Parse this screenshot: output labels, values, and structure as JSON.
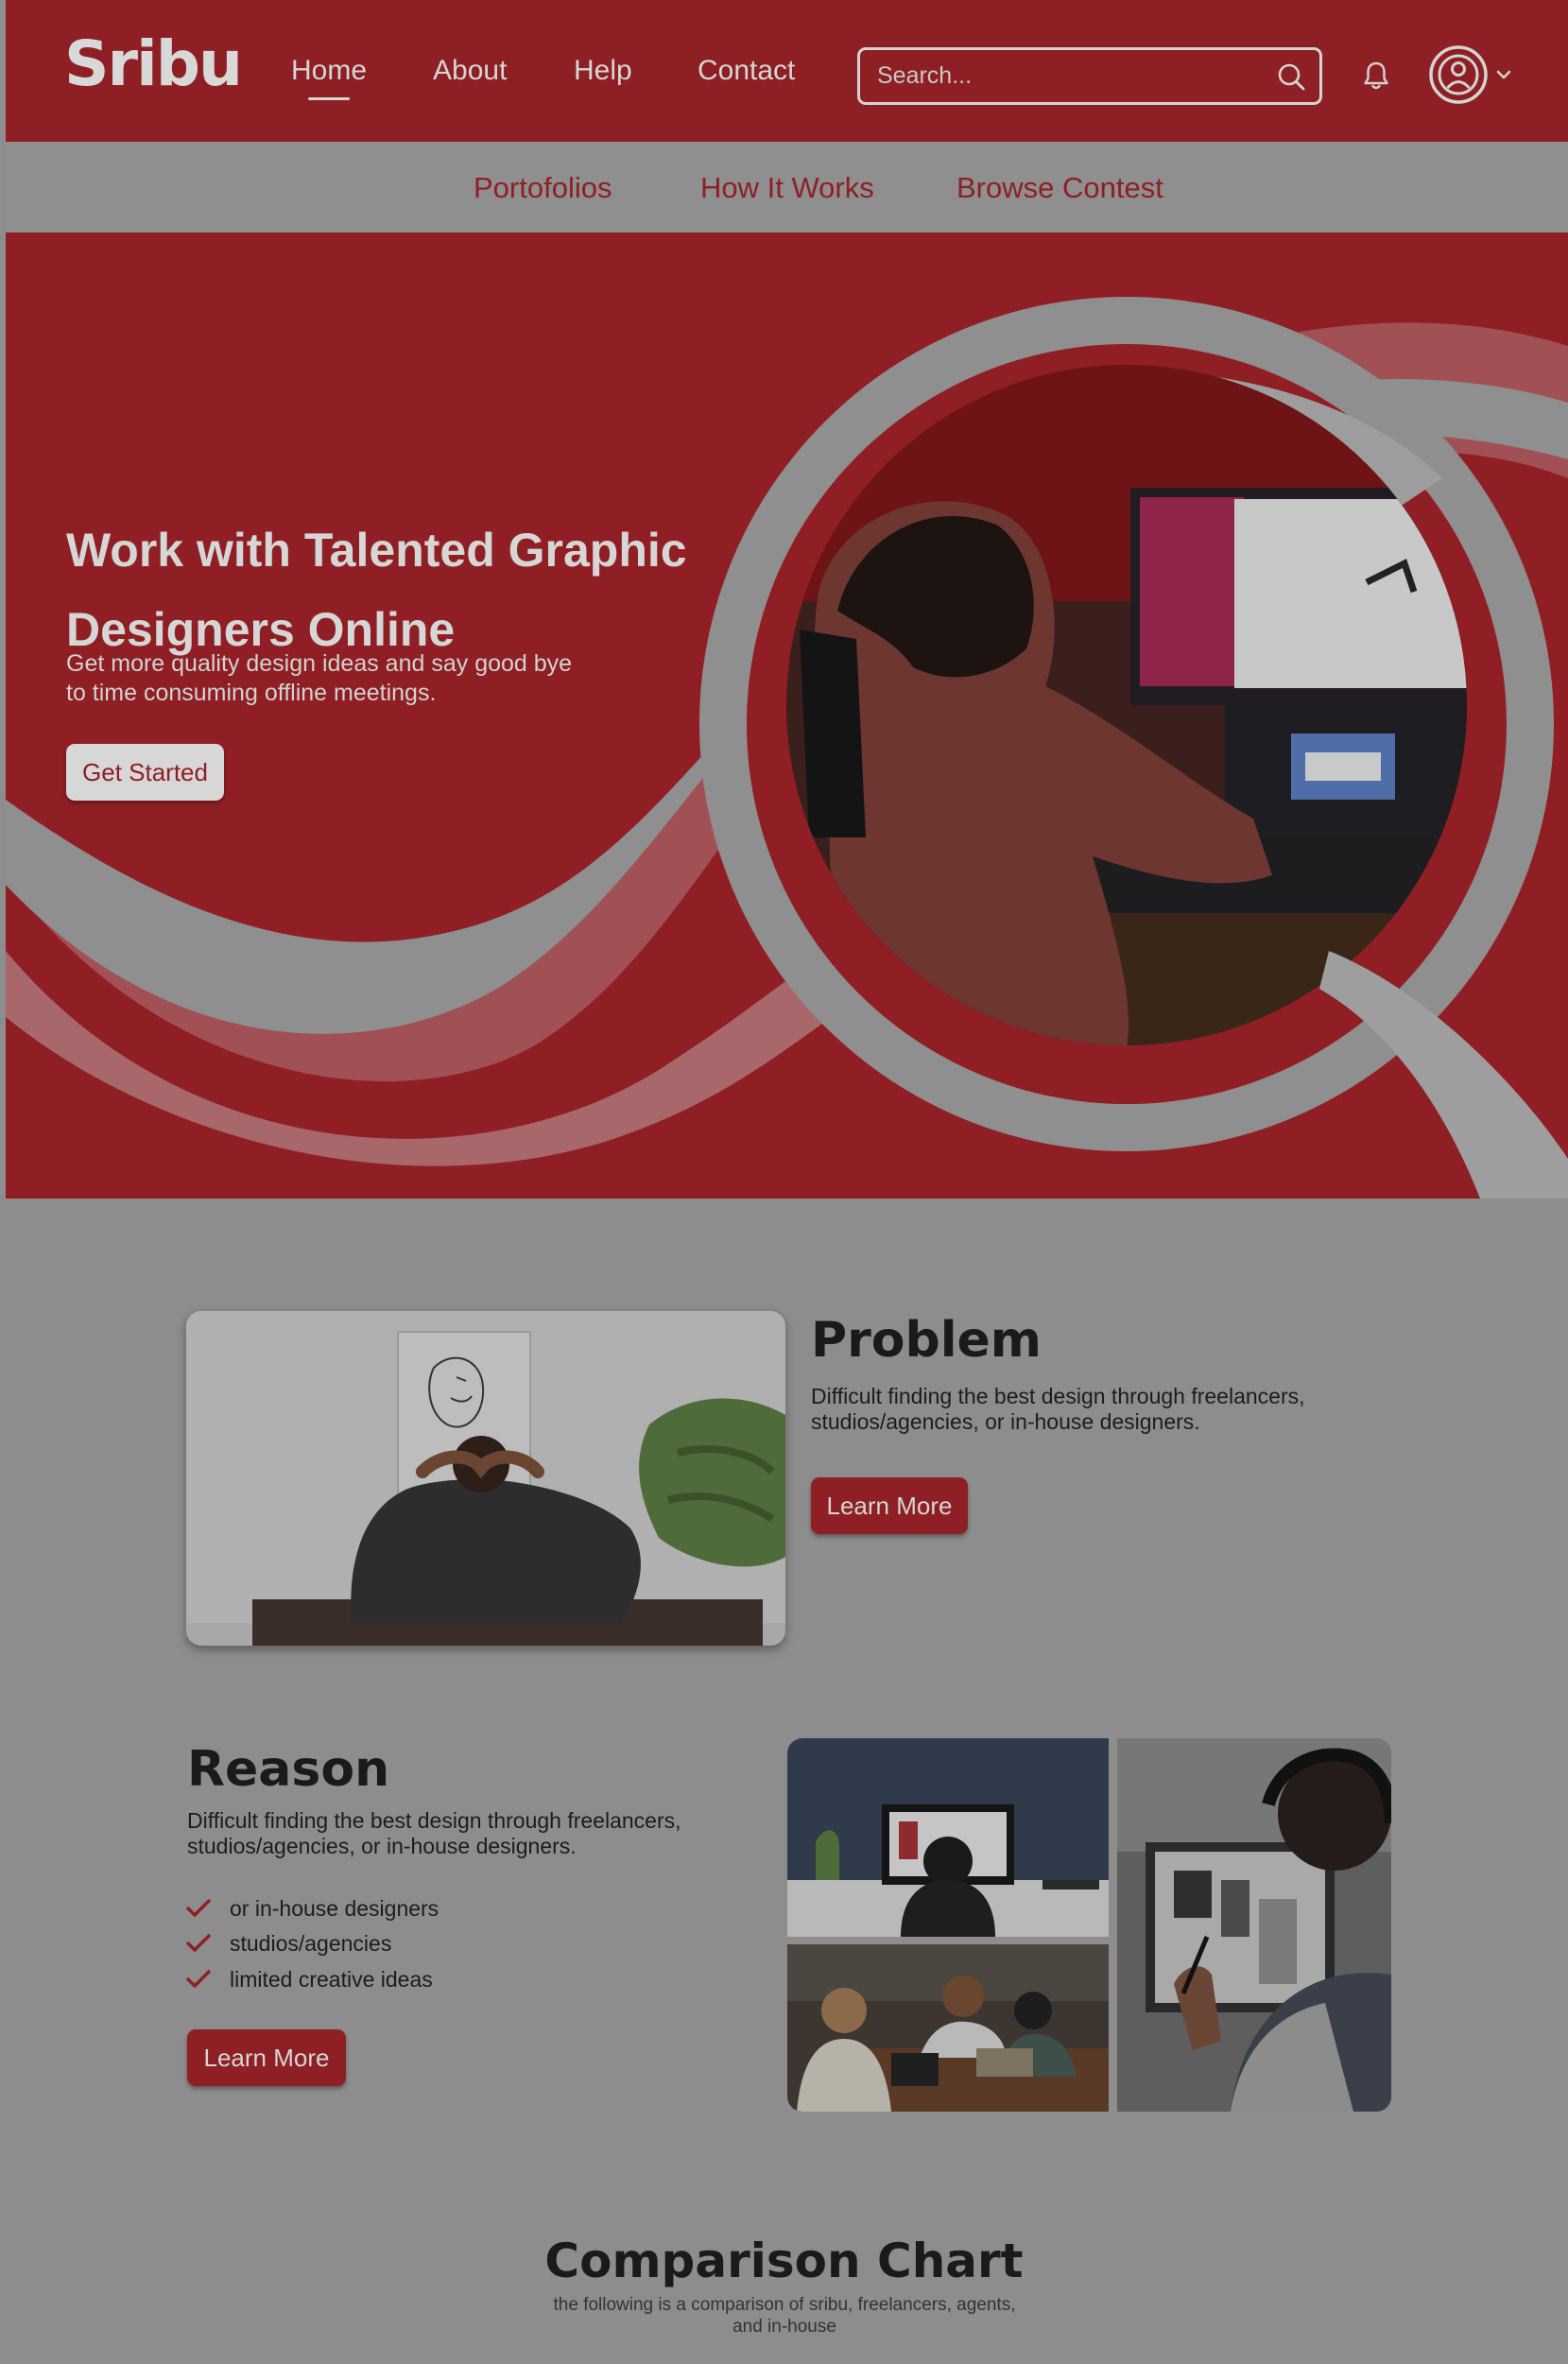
{
  "brand": {
    "logo_text": "Sribu"
  },
  "nav": {
    "links": [
      "Home",
      "About",
      "Help",
      "Contact"
    ],
    "active": "Home",
    "search_placeholder": "Search..."
  },
  "subnav": {
    "links": [
      "Portofolios",
      "How It Works",
      "Browse Contest"
    ]
  },
  "hero": {
    "title": "Work with Talented Graphic Designers Online",
    "subtitle": "Get more quality design ideas and say good bye to time consuming offline meetings.",
    "cta": "Get Started"
  },
  "problem": {
    "heading": "Problem",
    "text": "Difficult finding the best design through freelancers, studios/agencies, or in-house designers.",
    "cta": "Learn More"
  },
  "reason": {
    "heading": "Reason",
    "text": "Difficult finding the best design through freelancers, studios/agencies, or in-house designers.",
    "checklist": [
      "or in-house designers",
      "studios/agencies",
      "limited creative ideas"
    ],
    "cta": "Learn More"
  },
  "comparison": {
    "heading": "Comparison Chart",
    "subtitle": "the following is a comparison of sribu, freelancers, agents, and in-house"
  },
  "colors": {
    "brand_red": "#8e1f24",
    "overlay_gray": "#8d8d8d",
    "light_text": "#d6d6d6",
    "dark_text": "#1a1a1a"
  },
  "icons": [
    "search-icon",
    "bell-icon",
    "user-avatar-icon",
    "chevron-down-icon",
    "checkmark-icon"
  ]
}
